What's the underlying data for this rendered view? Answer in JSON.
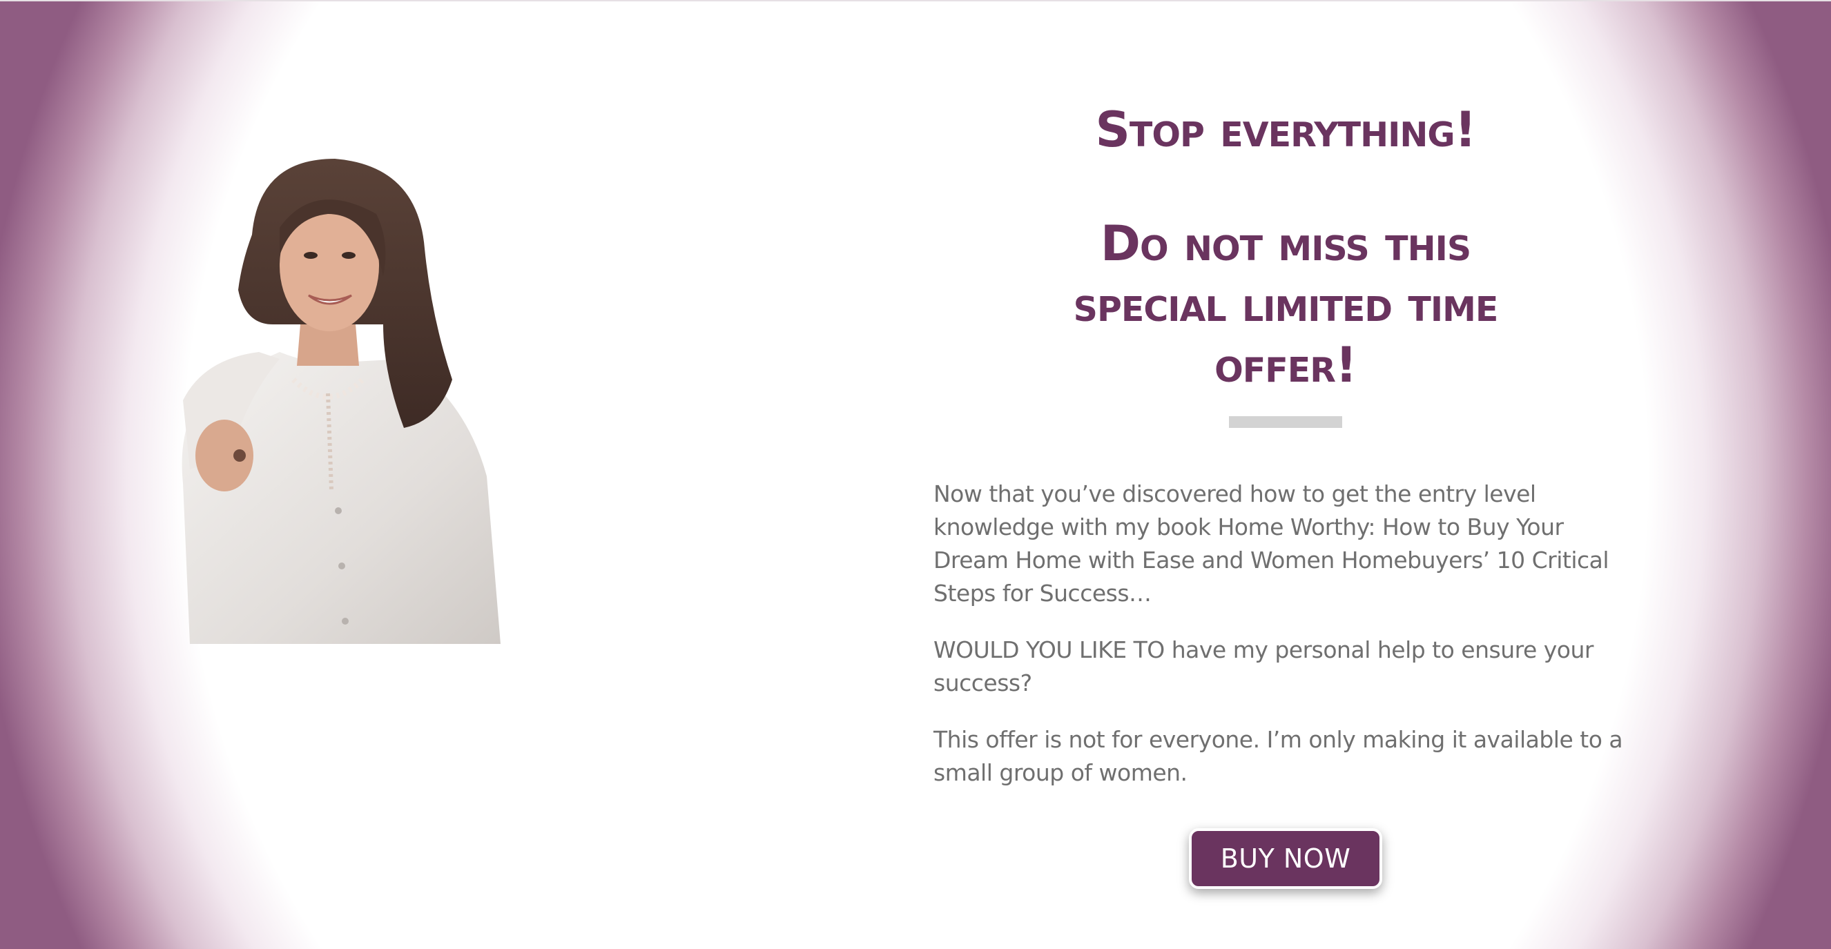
{
  "headline": {
    "line1": "Stop everything!",
    "line2": "Do not miss this special limited time offer!"
  },
  "paragraphs": [
    "Now that you’ve discovered how to get the entry level knowledge with my book Home Worthy: How to Buy Your Dream Home with Ease and Women Homebuyers’ 10 Critical Steps for Success…",
    "WOULD YOU LIKE TO have my personal help to ensure your success?",
    "This offer is not for everyone. I’m only making it available to a small group of women."
  ],
  "cta": {
    "label": "BUY NOW"
  },
  "colors": {
    "accent": "#6a345f",
    "text": "#6f6f6f",
    "divider": "#d3d3d3",
    "vignette": "#8f5c82"
  }
}
